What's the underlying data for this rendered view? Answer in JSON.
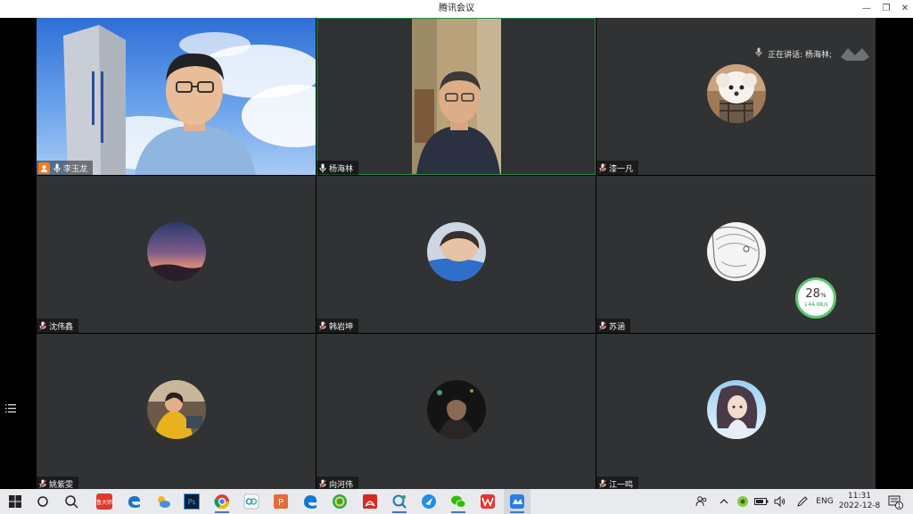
{
  "window": {
    "title": "腾讯会议",
    "controls": {
      "minimize": "—",
      "restore": "❐",
      "close": "✕"
    }
  },
  "speaking": {
    "label": "正在讲话: 杨海林;"
  },
  "network": {
    "percent": "28",
    "unit": "%",
    "rate": "↓44.6K/s"
  },
  "participants": [
    {
      "name": "李玉龙",
      "tile": "video",
      "host": true
    },
    {
      "name": "杨海林",
      "tile": "video",
      "active": true
    },
    {
      "name": "漆一凡",
      "tile": "avatar"
    },
    {
      "name": "沈伟鑫",
      "tile": "avatar"
    },
    {
      "name": "韩岩坤",
      "tile": "avatar"
    },
    {
      "name": "苏涵",
      "tile": "avatar"
    },
    {
      "name": "姚紫雯",
      "tile": "avatar"
    },
    {
      "name": "向河伟",
      "tile": "avatar"
    },
    {
      "name": "江一鸣",
      "tile": "avatar"
    }
  ],
  "taskbar": {
    "apps": [
      "windows-start",
      "search-circle",
      "cortana",
      "ludashi",
      "edge-legacy",
      "weather-app",
      "photoshop",
      "chrome",
      "baidu-netdisk",
      "powerpoint",
      "edge",
      "browser-360",
      "acrobat",
      "snipping-tool",
      "feishu",
      "wechat",
      "wps",
      "tencent-meeting"
    ],
    "ludashi_label": "鲁大师",
    "ps_label": "Ps",
    "language": "ENG",
    "time": "11:31",
    "date": "2022-12-8",
    "notification_badge": "1"
  },
  "colors": {
    "tile_bg": "#303234",
    "active_border": "#1f8f4a",
    "host_badge": "#f57a20",
    "taskbar_bg": "#e9eaee"
  }
}
